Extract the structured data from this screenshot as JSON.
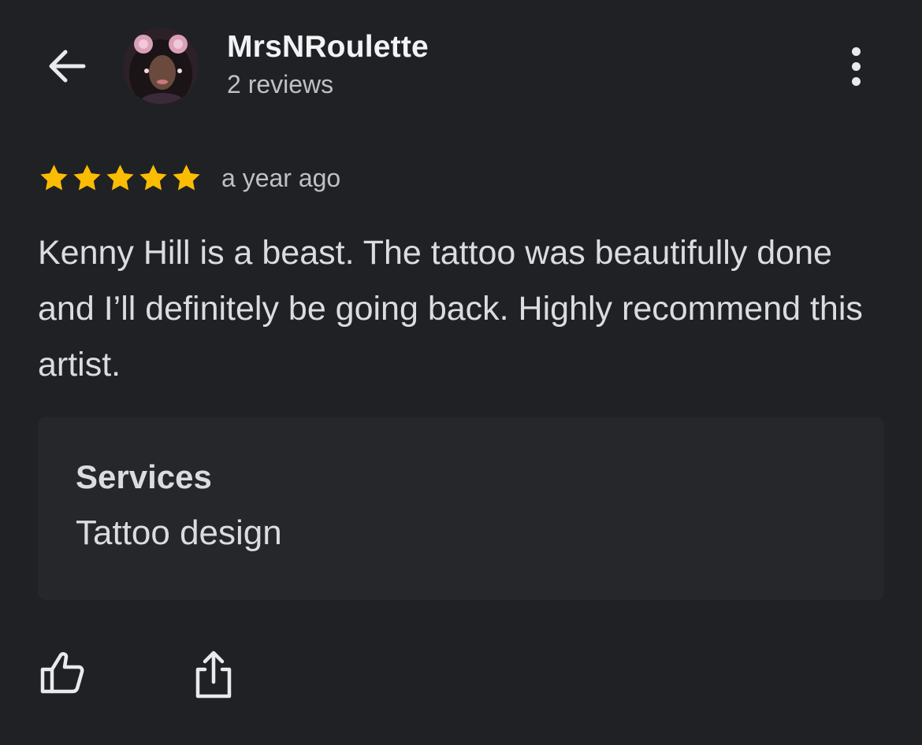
{
  "colors": {
    "background": "#202124",
    "card_background": "#26272b",
    "star": "#fbbc04",
    "text_primary": "#f1f3f4",
    "text_secondary": "#bdc1c6"
  },
  "header": {
    "back_icon": "arrow-left-icon",
    "user_name": "MrsNRoulette",
    "review_count": "2 reviews",
    "more_icon": "more-vertical-icon"
  },
  "review": {
    "rating": 5,
    "rating_max": 5,
    "date": "a year ago",
    "text": "Kenny Hill is a beast. The tattoo was beautifully done and I’ll definitely be going back. Highly recommend this artist."
  },
  "services": {
    "title": "Services",
    "value": "Tattoo design"
  },
  "actions": {
    "like_icon": "thumbs-up-icon",
    "share_icon": "share-icon"
  }
}
